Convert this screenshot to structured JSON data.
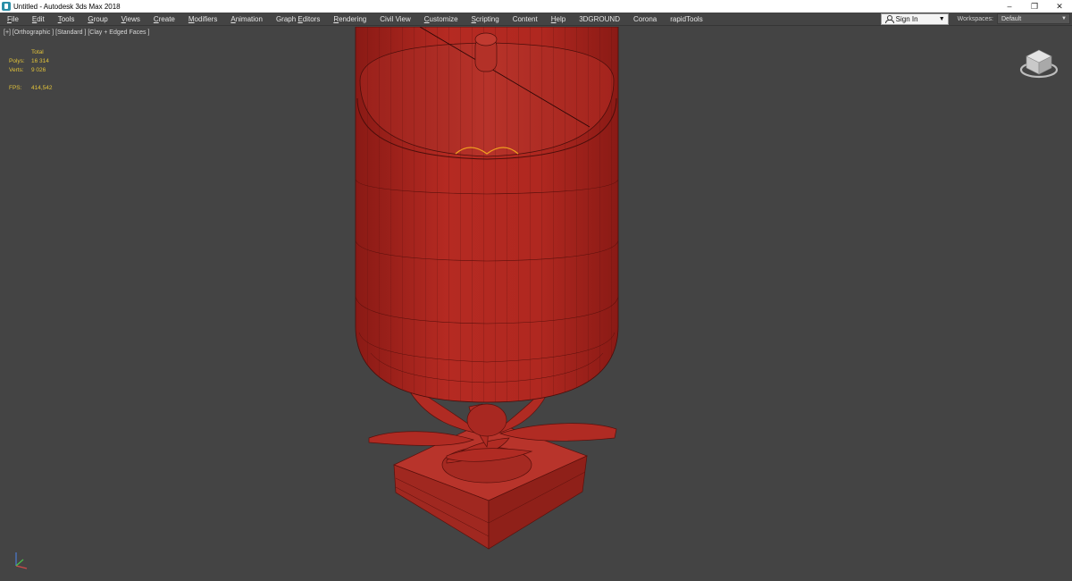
{
  "window": {
    "title": "Untitled - Autodesk 3ds Max 2018",
    "minimize": "–",
    "restore": "❐",
    "close": "✕"
  },
  "menu": {
    "items": [
      {
        "label": "File",
        "ul": "F"
      },
      {
        "label": "Edit",
        "ul": "E"
      },
      {
        "label": "Tools",
        "ul": "T"
      },
      {
        "label": "Group",
        "ul": "G"
      },
      {
        "label": "Views",
        "ul": "V"
      },
      {
        "label": "Create",
        "ul": "C"
      },
      {
        "label": "Modifiers",
        "ul": "M"
      },
      {
        "label": "Animation",
        "ul": "A"
      },
      {
        "label": "Graph Editors",
        "ul": "E"
      },
      {
        "label": "Rendering",
        "ul": "R"
      },
      {
        "label": "Civil View",
        "ul": ""
      },
      {
        "label": "Customize",
        "ul": "C"
      },
      {
        "label": "Scripting",
        "ul": "S"
      },
      {
        "label": "Content",
        "ul": ""
      },
      {
        "label": "Help",
        "ul": "H"
      },
      {
        "label": "3DGROUND",
        "ul": ""
      },
      {
        "label": "Corona",
        "ul": ""
      },
      {
        "label": "rapidTools",
        "ul": ""
      }
    ],
    "sign_in": "Sign In",
    "workspaces_label": "Workspaces:",
    "workspaces_value": "Default"
  },
  "viewport": {
    "label": "[+] [Orthographic ] [Standard ] [Clay + Edged Faces ]",
    "stats": {
      "total": "Total",
      "polys_label": "Polys:",
      "polys_value": "16 314",
      "verts_label": "Verts:",
      "verts_value": "9 026",
      "fps_label": "FPS:",
      "fps_value": "414,542"
    }
  },
  "colors": {
    "viewport_bg": "#444444",
    "model_red": "#b52a22",
    "stats_yellow": "#e1c23a",
    "selection_orange": "#f0a020"
  }
}
